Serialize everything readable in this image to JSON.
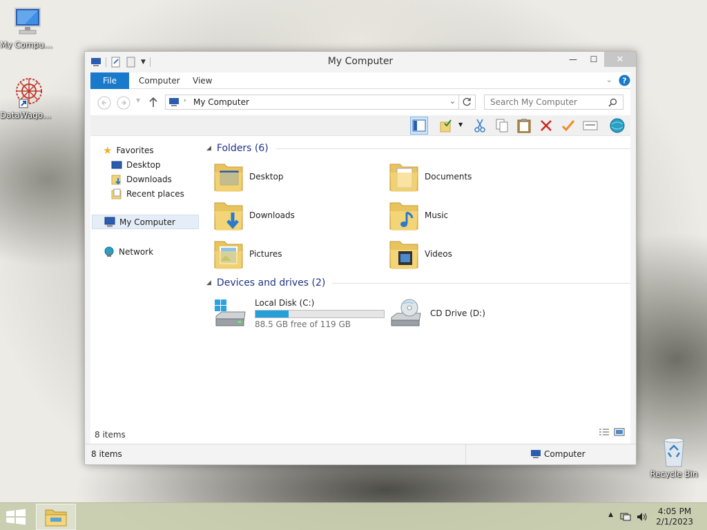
{
  "desktop": {
    "icons": [
      {
        "label": "My Computer"
      },
      {
        "label": "DataWagon..."
      },
      {
        "label": "Recycle Bin"
      }
    ]
  },
  "window": {
    "title": "My Computer",
    "ribbon_tabs": [
      "File",
      "Computer",
      "View"
    ],
    "address": "My Computer",
    "search_placeholder": "Search My Computer",
    "nav": {
      "favorites": "Favorites",
      "desktop": "Desktop",
      "downloads": "Downloads",
      "recent": "Recent places",
      "computer": "My Computer",
      "network": "Network"
    },
    "groups": {
      "folders": "Folders (6)",
      "devices": "Devices and drives (2)"
    },
    "folders": [
      {
        "name": "Desktop"
      },
      {
        "name": "Documents"
      },
      {
        "name": "Downloads"
      },
      {
        "name": "Music"
      },
      {
        "name": "Pictures"
      },
      {
        "name": "Videos"
      }
    ],
    "drives": [
      {
        "name": "Local Disk (C:)",
        "free": "88.5 GB free of 119 GB",
        "used_fraction": 0.256
      },
      {
        "name": "CD Drive (D:)"
      }
    ],
    "item_count_inner": "8 items",
    "status": {
      "items": "8 items",
      "location": "Computer"
    }
  },
  "taskbar": {
    "time": "4:05 PM",
    "date": "2/1/2023"
  },
  "colors": {
    "accent": "#1979ca",
    "group_title": "#1e3287",
    "drive_bar": "#26a0da"
  }
}
